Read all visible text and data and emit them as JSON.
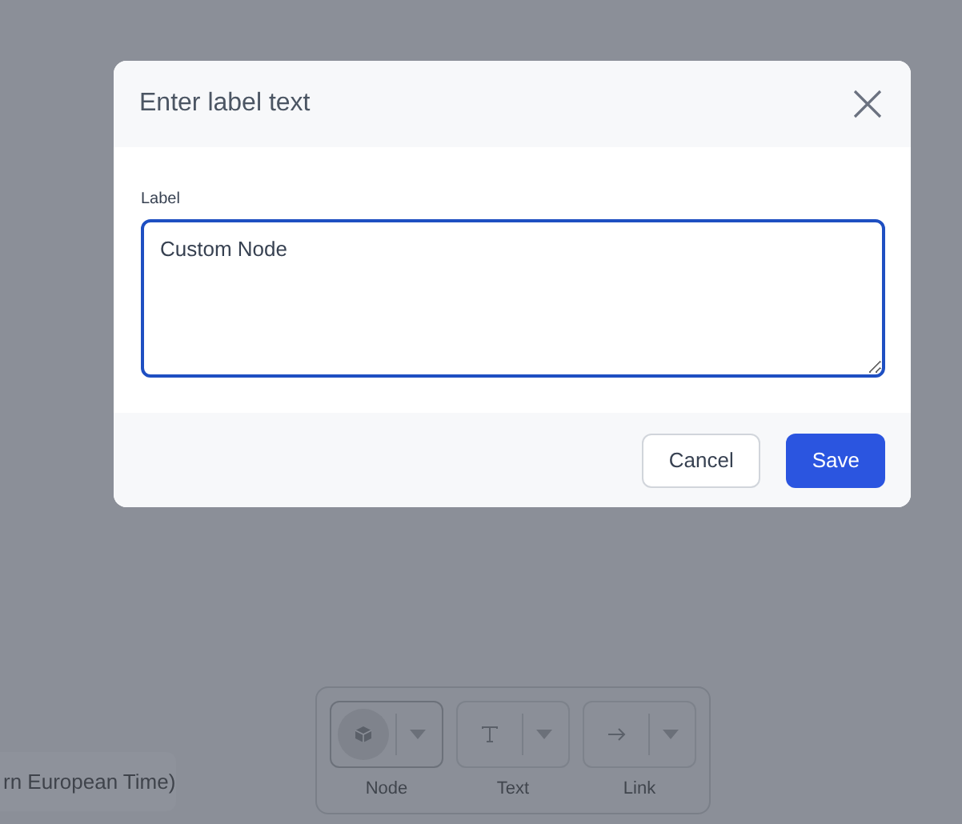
{
  "background": {
    "timezone_text": "rn European Time)"
  },
  "toolbar": {
    "tools": [
      {
        "label": "Node",
        "selected": true
      },
      {
        "label": "Text",
        "selected": false
      },
      {
        "label": "Link",
        "selected": false
      }
    ]
  },
  "dialog": {
    "title": "Enter label text",
    "field_label": "Label",
    "value": "Custom Node",
    "buttons": [
      {
        "label": "Cancel",
        "kind": "secondary"
      },
      {
        "label": "Save",
        "kind": "primary"
      }
    ]
  }
}
